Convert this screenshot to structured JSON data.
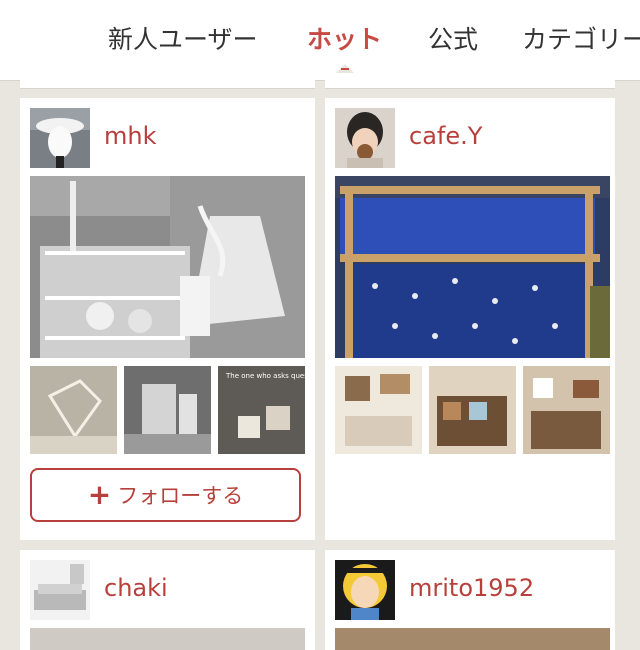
{
  "tabs": [
    {
      "label": "新人ユーザー",
      "active": false
    },
    {
      "label": "ホット",
      "active": true
    },
    {
      "label": "公式",
      "active": false
    },
    {
      "label": "カテゴリー",
      "active": false
    }
  ],
  "colors": {
    "accent": "#c84a44",
    "username": "#b8403c",
    "background": "#e9e5df"
  },
  "cards": [
    {
      "username": "mhk",
      "follow_label": "フォローする",
      "follow_icon": "plus-icon"
    },
    {
      "username": "cafe.Y"
    },
    {
      "username": "chaki"
    },
    {
      "username": "mrito1952"
    }
  ],
  "thumb_text": "The one who asks question"
}
